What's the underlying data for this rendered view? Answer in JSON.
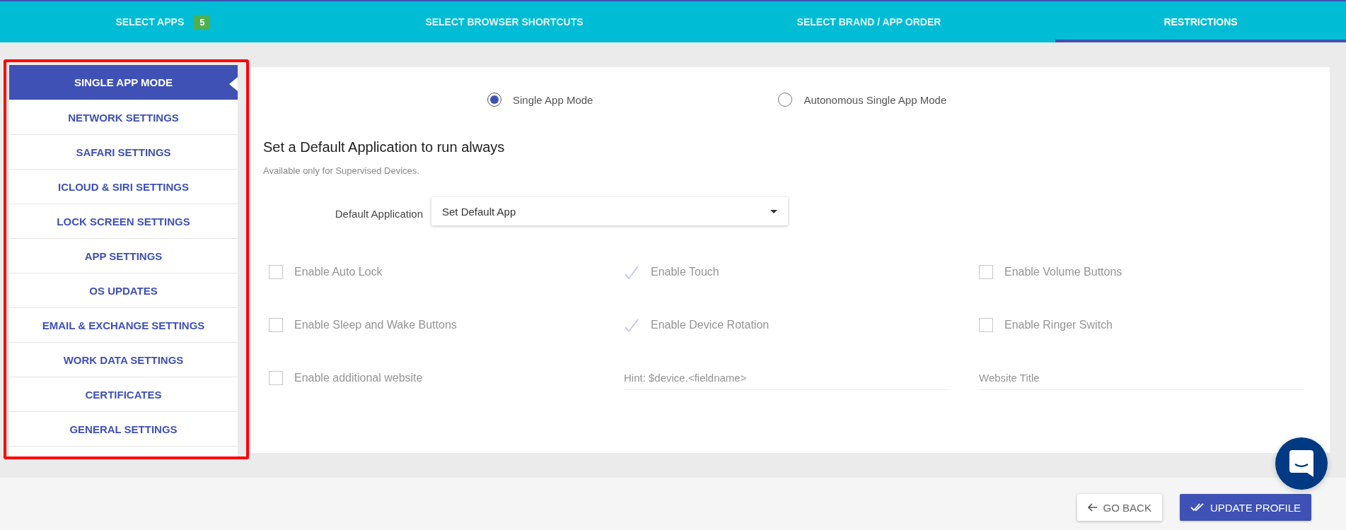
{
  "tabs": [
    {
      "label": "SELECT APPS",
      "badge": "5",
      "selected": false
    },
    {
      "label": "SELECT BROWSER SHORTCUTS",
      "selected": false
    },
    {
      "label": "SELECT BRAND / APP ORDER",
      "selected": false
    },
    {
      "label": "RESTRICTIONS",
      "selected": true
    }
  ],
  "sidebar": {
    "items": [
      {
        "label": "SINGLE APP MODE",
        "selected": true
      },
      {
        "label": "NETWORK SETTINGS",
        "selected": false
      },
      {
        "label": "SAFARI SETTINGS",
        "selected": false
      },
      {
        "label": "ICLOUD & SIRI SETTINGS",
        "selected": false
      },
      {
        "label": "LOCK SCREEN SETTINGS",
        "selected": false
      },
      {
        "label": "APP SETTINGS",
        "selected": false
      },
      {
        "label": "OS UPDATES",
        "selected": false
      },
      {
        "label": "EMAIL & EXCHANGE SETTINGS",
        "selected": false
      },
      {
        "label": "WORK DATA SETTINGS",
        "selected": false
      },
      {
        "label": "CERTIFICATES",
        "selected": false
      },
      {
        "label": "GENERAL SETTINGS",
        "selected": false
      }
    ]
  },
  "mode_options": [
    {
      "label": "Single App Mode",
      "selected": true
    },
    {
      "label": "Autonomous Single App Mode",
      "selected": false
    }
  ],
  "heading": "Set a Default Application to run always",
  "subtext": "Available only for Supervised Devices.",
  "default_application": {
    "label": "Default Application",
    "value": "Set Default App"
  },
  "options": [
    {
      "kind": "checkbox",
      "label": "Enable Auto Lock",
      "checked": false,
      "disabled": true
    },
    {
      "kind": "checkbox",
      "label": "Enable Touch",
      "checked": true,
      "disabled": true
    },
    {
      "kind": "checkbox",
      "label": "Enable Volume Buttons",
      "checked": false,
      "disabled": true
    },
    {
      "kind": "checkbox",
      "label": "Enable Sleep and Wake Buttons",
      "checked": false,
      "disabled": true
    },
    {
      "kind": "checkbox",
      "label": "Enable Device Rotation",
      "checked": true,
      "disabled": true
    },
    {
      "kind": "checkbox",
      "label": "Enable Ringer Switch",
      "checked": false,
      "disabled": true
    },
    {
      "kind": "checkbox",
      "label": "Enable additional website",
      "checked": false,
      "disabled": true
    },
    {
      "kind": "field",
      "placeholder": "Hint: $device.<fieldname>",
      "disabled": true
    },
    {
      "kind": "field",
      "placeholder": "Website Title",
      "disabled": true
    }
  ],
  "buttons": [
    {
      "kind": "back",
      "label": "GO BACK"
    },
    {
      "kind": "primary",
      "label": "UPDATE PROFILE"
    }
  ]
}
